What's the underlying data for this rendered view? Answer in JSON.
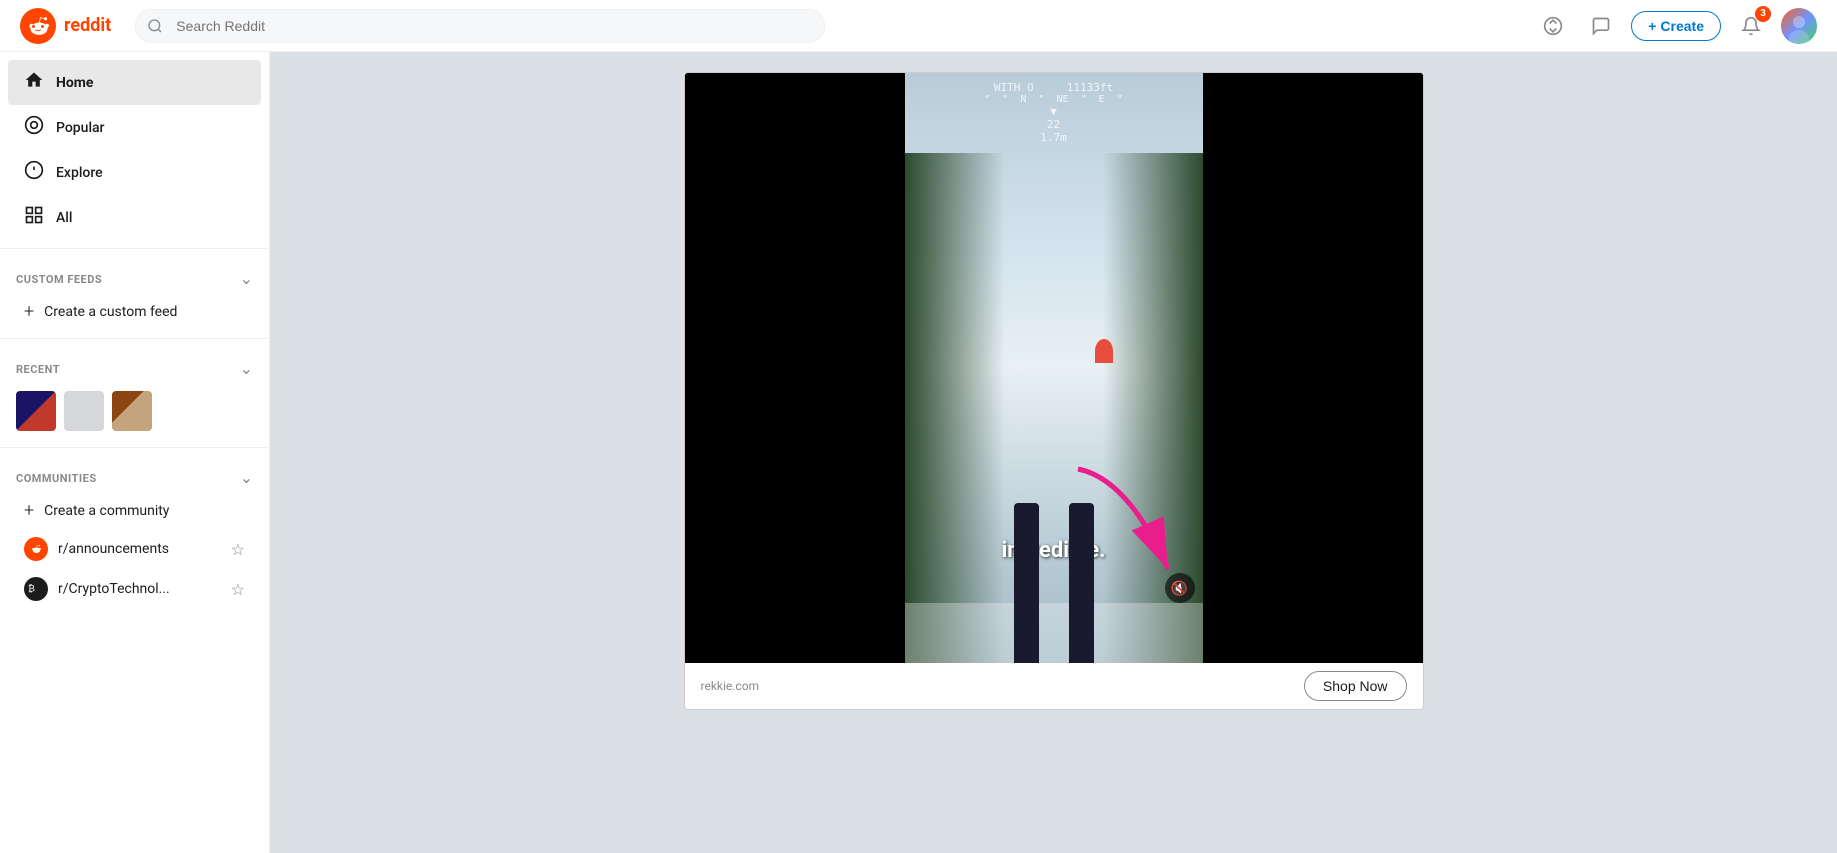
{
  "app": {
    "name": "reddit",
    "logo_alt": "Reddit"
  },
  "topnav": {
    "search_placeholder": "Search Reddit",
    "create_label": "Create",
    "notification_count": "3"
  },
  "sidebar": {
    "nav_items": [
      {
        "id": "home",
        "label": "Home",
        "icon": "home",
        "active": true
      },
      {
        "id": "popular",
        "label": "Popular",
        "icon": "popular"
      },
      {
        "id": "explore",
        "label": "Explore",
        "icon": "explore"
      },
      {
        "id": "all",
        "label": "All",
        "icon": "all"
      }
    ],
    "custom_feeds": {
      "section_label": "CUSTOM FEEDS",
      "add_label": "Create a custom feed"
    },
    "recent": {
      "section_label": "RECENT"
    },
    "communities": {
      "section_label": "COMMUNITIES",
      "add_label": "Create a community",
      "items": [
        {
          "name": "r/announcements",
          "color": "#ff4500"
        },
        {
          "name": "r/CryptoTechnol...",
          "color": "#1c1c1c"
        }
      ]
    }
  },
  "post": {
    "hud_top": "WITH O    11133ft\n\" \" N \" NE \" E \"\n22\n1.7m",
    "subtitle": "incredible.",
    "source": "rekkie.com",
    "shop_now_label": "Shop Now",
    "mute_icon": "🔇"
  }
}
